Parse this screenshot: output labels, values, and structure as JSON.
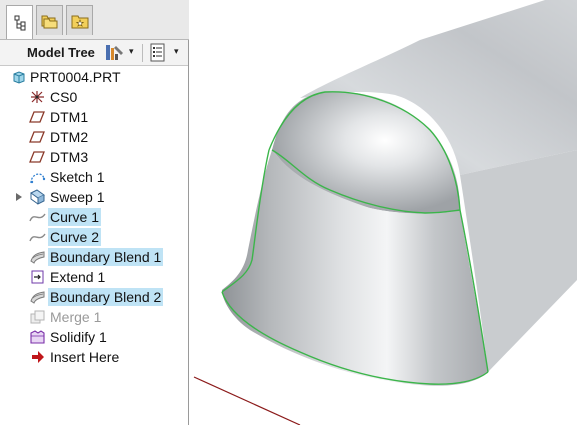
{
  "panel": {
    "tabs": [
      {
        "icon": "model-tree-icon"
      },
      {
        "icon": "folder-browser-icon"
      },
      {
        "icon": "favorites-icon"
      }
    ],
    "toolbar": {
      "title": "Model Tree",
      "tools_dropdown": "▾",
      "settings_dropdown": "▾"
    }
  },
  "tree": {
    "root": "PRT0004.PRT",
    "items": [
      {
        "label": "CS0",
        "icon": "coordinate-system-icon",
        "state": "normal"
      },
      {
        "label": "DTM1",
        "icon": "datum-plane-icon",
        "state": "normal"
      },
      {
        "label": "DTM2",
        "icon": "datum-plane-icon",
        "state": "normal"
      },
      {
        "label": "DTM3",
        "icon": "datum-plane-icon",
        "state": "normal"
      },
      {
        "label": "Sketch 1",
        "icon": "sketch-icon",
        "state": "normal"
      },
      {
        "label": "Sweep 1",
        "icon": "sweep-icon",
        "state": "normal",
        "expandable": true
      },
      {
        "label": "Curve 1",
        "icon": "curve-icon",
        "state": "selected"
      },
      {
        "label": "Curve 2",
        "icon": "curve-icon",
        "state": "selected"
      },
      {
        "label": "Boundary Blend 1",
        "icon": "boundary-blend-icon",
        "state": "selected"
      },
      {
        "label": "Extend 1",
        "icon": "extend-icon",
        "state": "normal"
      },
      {
        "label": "Boundary Blend 2",
        "icon": "boundary-blend-icon",
        "state": "selected"
      },
      {
        "label": "Merge 1",
        "icon": "merge-icon",
        "state": "suppressed"
      },
      {
        "label": "Solidify 1",
        "icon": "solidify-icon",
        "state": "normal"
      },
      {
        "label": "Insert Here",
        "icon": "insert-here-arrow-icon",
        "state": "normal"
      }
    ]
  },
  "colors": {
    "selection": "#bfe3f5",
    "edge_highlight": "#3bb54a",
    "datum_axis": "#8b1a1a"
  }
}
